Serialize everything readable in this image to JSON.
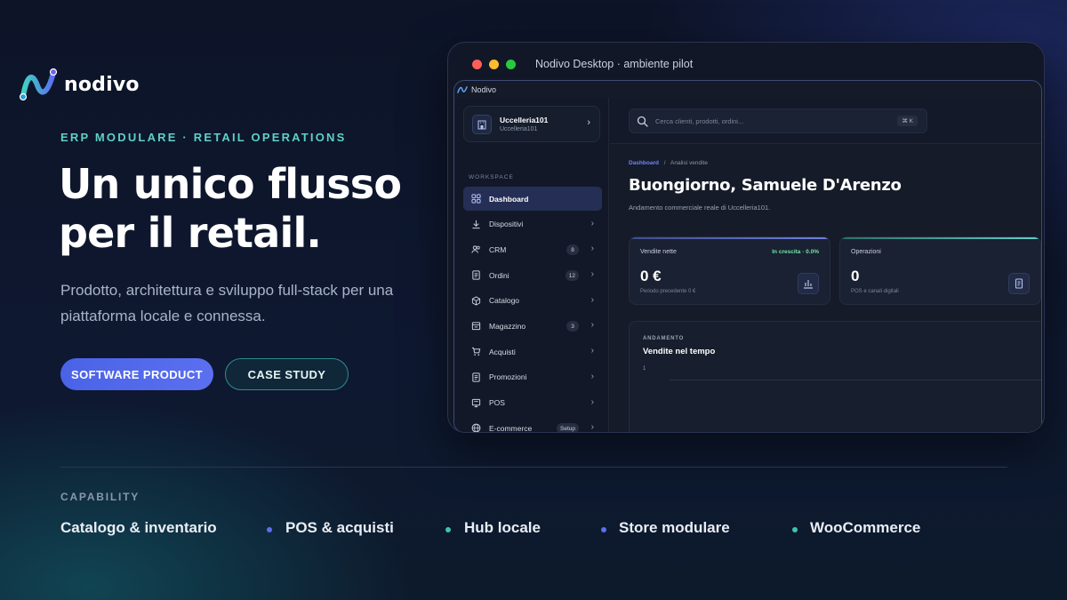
{
  "brand": {
    "name": "nodivo"
  },
  "hero": {
    "eyebrow": "ERP MODULARE · RETAIL OPERATIONS",
    "headline": "Un unico flusso per il retail.",
    "subtext": "Prodotto, architettura e sviluppo full-stack per una piattaforma locale e connessa.",
    "primary_cta": "SOFTWARE PRODUCT",
    "secondary_cta": "CASE STUDY"
  },
  "window": {
    "title": "Nodivo Desktop · ambiente pilot",
    "app_name": "Nodivo",
    "company": {
      "name": "Uccelleria101",
      "sub": "Uccelleria101"
    },
    "section_label": "WORKSPACE",
    "nav": [
      {
        "label": "Dashboard",
        "icon": "grid-icon",
        "active": true
      },
      {
        "label": "Dispositivi",
        "icon": "download-icon"
      },
      {
        "label": "CRM",
        "icon": "users-icon",
        "badge": "8"
      },
      {
        "label": "Ordini",
        "icon": "document-icon",
        "badge": "12"
      },
      {
        "label": "Catalogo",
        "icon": "box-icon"
      },
      {
        "label": "Magazzino",
        "icon": "warehouse-icon",
        "badge": "3"
      },
      {
        "label": "Acquisti",
        "icon": "cart-icon"
      },
      {
        "label": "Promozioni",
        "icon": "tag-icon"
      },
      {
        "label": "POS",
        "icon": "pos-icon"
      },
      {
        "label": "E-commerce",
        "icon": "globe-icon",
        "badge": "Setup"
      }
    ],
    "search": {
      "placeholder": "Cerca clienti, prodotti, ordini...",
      "shortcut": "⌘ K"
    },
    "breadcrumb": {
      "current": "Dashboard",
      "separator": "/",
      "page": "Analisi vendite"
    },
    "greeting": "Buongiorno, Samuele D'Arenzo",
    "greeting_sub": "Andamento commerciale reale di Uccelleria101.",
    "kpis": [
      {
        "label": "Vendite nette",
        "trend": "In crescita · 0.0%",
        "value": "0 €",
        "sub": "Periodo precedente 0 €"
      },
      {
        "label": "Operazioni",
        "value": "0",
        "sub": "POS e canali digitali"
      }
    ],
    "chart_card": {
      "eyebrow": "ANDAMENTO",
      "title": "Vendite nel tempo",
      "tick": "1"
    }
  },
  "capability": {
    "label": "CAPABILITY",
    "items": [
      "Catalogo & inventario",
      "POS & acquisti",
      "Hub locale",
      "Store modulare",
      "WooCommerce"
    ],
    "dot_colors": [
      "#5b6ff0",
      "#3fc2b4",
      "#5b6ff0",
      "#3fc2b4"
    ]
  },
  "colors": {
    "accent_blue": "#5b6ff0",
    "accent_teal": "#5fd0c6",
    "positive": "#6ee7a8"
  }
}
